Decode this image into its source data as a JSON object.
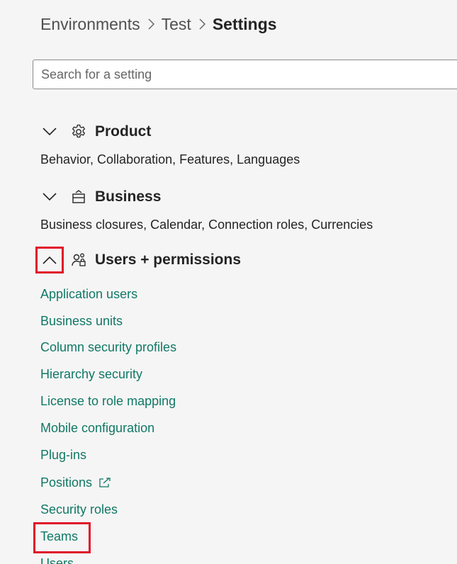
{
  "breadcrumb": {
    "items": [
      "Environments",
      "Test"
    ],
    "current": "Settings"
  },
  "search": {
    "placeholder": "Search for a setting"
  },
  "sections": [
    {
      "title": "Product",
      "icon": "gear-icon",
      "description": "Behavior, Collaboration, Features, Languages",
      "expanded": false
    },
    {
      "title": "Business",
      "icon": "business-icon",
      "description": "Business closures, Calendar, Connection roles, Currencies",
      "expanded": false
    },
    {
      "title": "Users + permissions",
      "icon": "users-permissions-icon",
      "expanded": true,
      "items": [
        "Application users",
        "Business units",
        "Column security profiles",
        "Hierarchy security",
        "License to role mapping",
        "Mobile configuration",
        "Plug-ins",
        "Positions",
        "Security roles",
        "Teams",
        "Users"
      ]
    }
  ],
  "colors": {
    "link": "#117865",
    "highlight": "#e0142a",
    "background": "#f5f5f5"
  }
}
